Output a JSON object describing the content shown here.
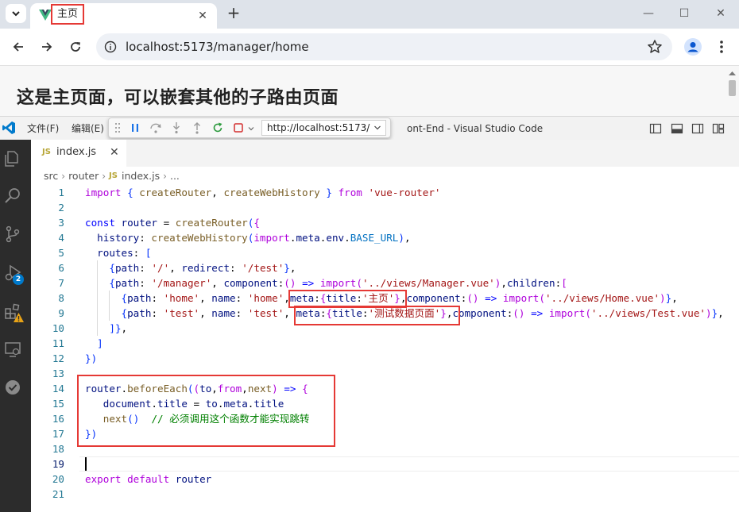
{
  "browser": {
    "tab_title": "主页",
    "url": "localhost:5173/manager/home",
    "new_tab_label": "+",
    "close_label": "✕",
    "minimize_label": "—",
    "maximize_label": "☐",
    "window_close_label": "✕"
  },
  "page": {
    "heading": "这是主页面，可以嵌套其他的子路由页面"
  },
  "vscode": {
    "menu": [
      {
        "label": "文件(F)"
      },
      {
        "label": "编辑(E)"
      }
    ],
    "window_title": "ont-End - Visual Studio Code",
    "debug_url": "http://localhost:5173/",
    "badges": {
      "run_debug": "2"
    },
    "tab": {
      "icon": "JS",
      "label": "index.js",
      "close": "✕"
    },
    "breadcrumbs": {
      "items": [
        "src",
        "router",
        "index.js",
        "..."
      ],
      "separator": "›",
      "file_icon": "JS"
    },
    "cursor_line": 19,
    "code_lines": [
      {
        "n": "1",
        "t": "import { createRouter, createWebHistory } from 'vue-router'"
      },
      {
        "n": "2",
        "t": ""
      },
      {
        "n": "3",
        "t": "const router = createRouter({"
      },
      {
        "n": "4",
        "t": "  history: createWebHistory(import.meta.env.BASE_URL),"
      },
      {
        "n": "5",
        "t": "  routes: ["
      },
      {
        "n": "6",
        "t": "    {path: '/', redirect: '/test'},"
      },
      {
        "n": "7",
        "t": "    {path: '/manager', component:() => import('../views/Manager.vue'),children:["
      },
      {
        "n": "8",
        "t": "      {path: 'home', name: 'home',meta:{title:'主页'},component:() => import('../views/Home.vue')},"
      },
      {
        "n": "9",
        "t": "      {path: 'test', name: 'test', meta:{title:'测试数据页面'},component:() => import('../views/Test.vue')},"
      },
      {
        "n": "10",
        "t": "    ]},"
      },
      {
        "n": "11",
        "t": "  ]"
      },
      {
        "n": "12",
        "t": "})"
      },
      {
        "n": "13",
        "t": ""
      },
      {
        "n": "14",
        "t": "router.beforeEach((to,from,next) => {"
      },
      {
        "n": "15",
        "t": "   document.title = to.meta.title"
      },
      {
        "n": "16",
        "t": "   next()  // 必须调用这个函数才能实现跳转"
      },
      {
        "n": "17",
        "t": "})"
      },
      {
        "n": "18",
        "t": ""
      },
      {
        "n": "19",
        "t": ""
      },
      {
        "n": "20",
        "t": "export default router"
      },
      {
        "n": "21",
        "t": ""
      }
    ]
  },
  "colors": {
    "annotation_red": "#e53935",
    "keyword_purple": "#af00db",
    "keyword_blue": "#0000ff",
    "string_red": "#a31515",
    "comment_green": "#008000",
    "activity_bar": "#2c2c2c",
    "vscode_blue": "#007acc",
    "vue_green": "#41b883"
  },
  "icons": {
    "browser": [
      "tab-list-icon",
      "vue-favicon",
      "back-arrow-icon",
      "forward-arrow-icon",
      "reload-icon",
      "site-info-icon",
      "bookmark-star-icon",
      "profile-icon",
      "more-vert-icon"
    ],
    "activity_bar": [
      "explorer-icon",
      "search-icon",
      "source-control-icon",
      "run-debug-icon",
      "extensions-icon",
      "remote-explorer-icon",
      "testing-icon"
    ],
    "debug_toolbar": [
      "drag-grip-icon",
      "pause-icon",
      "step-over-icon",
      "step-into-icon",
      "step-out-icon",
      "restart-icon",
      "stop-icon"
    ]
  }
}
